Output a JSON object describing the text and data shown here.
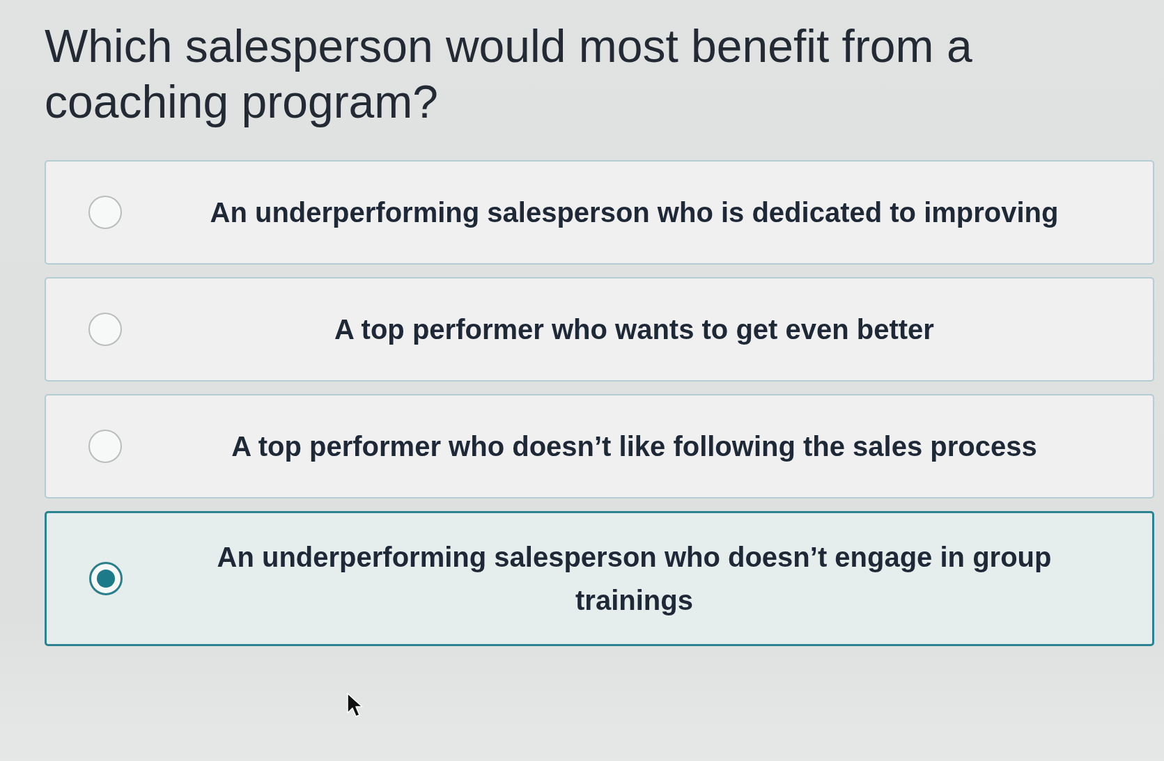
{
  "question": "Which salesperson would most benefit from a coaching program?",
  "options": [
    {
      "label": "An underperforming salesperson who is dedicated to improving",
      "selected": false
    },
    {
      "label": "A top performer who wants to get even better",
      "selected": false
    },
    {
      "label": "A top performer who doesn’t like following the sales process",
      "selected": false
    },
    {
      "label": "An underperforming salesperson who doesn’t engage in group trainings",
      "selected": true
    }
  ]
}
